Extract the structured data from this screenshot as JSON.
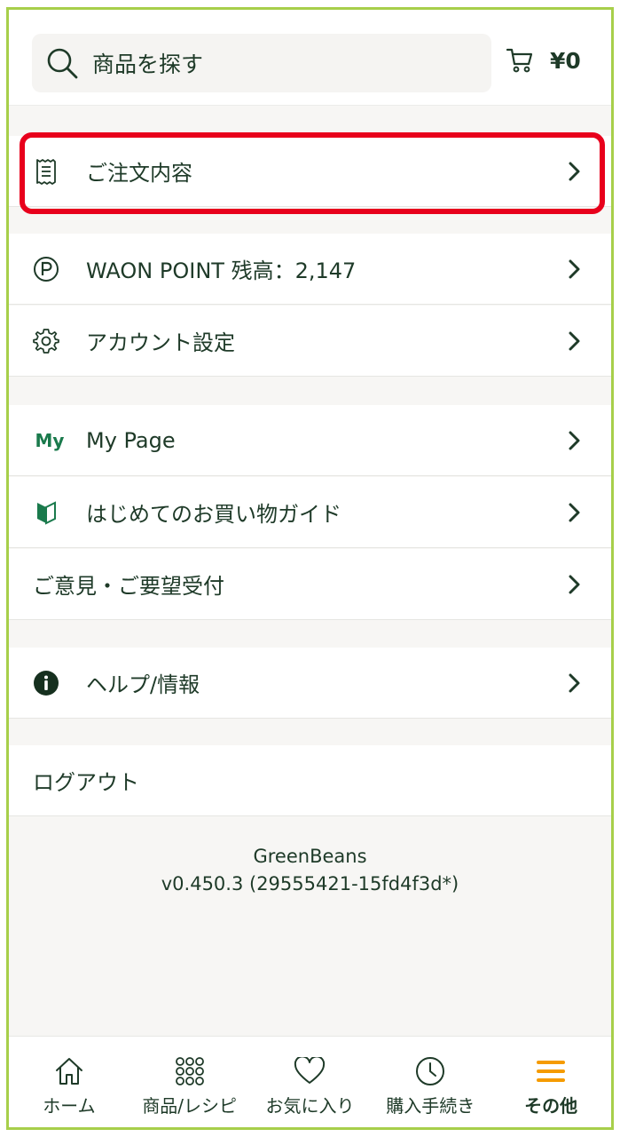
{
  "search": {
    "placeholder": "商品を探す"
  },
  "cart": {
    "amount": "¥0"
  },
  "menu": {
    "orders": "ご注文内容",
    "waon": "WAON POINT 残高：2,147",
    "account": "アカウント設定",
    "mypage_badge": "My",
    "mypage": "My Page",
    "guide": "はじめてのお買い物ガイド",
    "feedback": "ご意見・ご要望受付",
    "help": "ヘルプ/情報",
    "logout": "ログアウト"
  },
  "app": {
    "name": "GreenBeans",
    "version": "v0.450.3 (29555421-15fd4f3d*)"
  },
  "nav": [
    {
      "label": "ホーム",
      "icon": "home-icon"
    },
    {
      "label": "商品/レシピ",
      "icon": "grid-icon"
    },
    {
      "label": "お気に入り",
      "icon": "heart-icon"
    },
    {
      "label": "購入手続き",
      "icon": "clock-icon"
    },
    {
      "label": "その他",
      "icon": "menu-icon"
    }
  ],
  "colors": {
    "accent_green": "#1a7a4c",
    "highlight_red": "#e8001c",
    "active_orange": "#f59b00",
    "frame_green": "#a7cf4a"
  }
}
